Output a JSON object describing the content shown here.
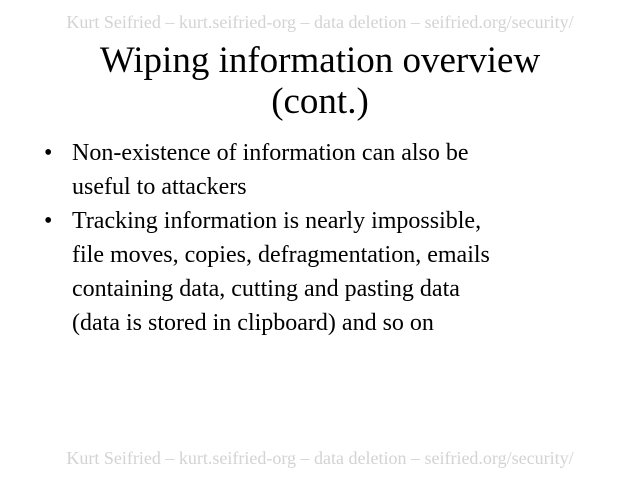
{
  "header": {
    "text": "Kurt Seifried – kurt.seifried-org – data deletion – seifried.org/security/"
  },
  "title": {
    "line1": "Wiping information overview",
    "line2": "(cont.)"
  },
  "bullets": [
    {
      "symbol": "•",
      "lines": [
        "Non-existence of information can also be",
        "useful to attackers"
      ]
    },
    {
      "symbol": "•",
      "lines": [
        "Tracking information is nearly impossible,",
        "file moves, copies, defragmentation, emails",
        "containing data, cutting and pasting data",
        "(data is stored in clipboard) and so on"
      ]
    }
  ],
  "footer": {
    "text": "Kurt Seifried – kurt.seifried-org – data deletion – seifried.org/security/"
  },
  "colors": {
    "background": "#ffffff",
    "text": "#000000",
    "watermark": "#d3d3d3"
  }
}
